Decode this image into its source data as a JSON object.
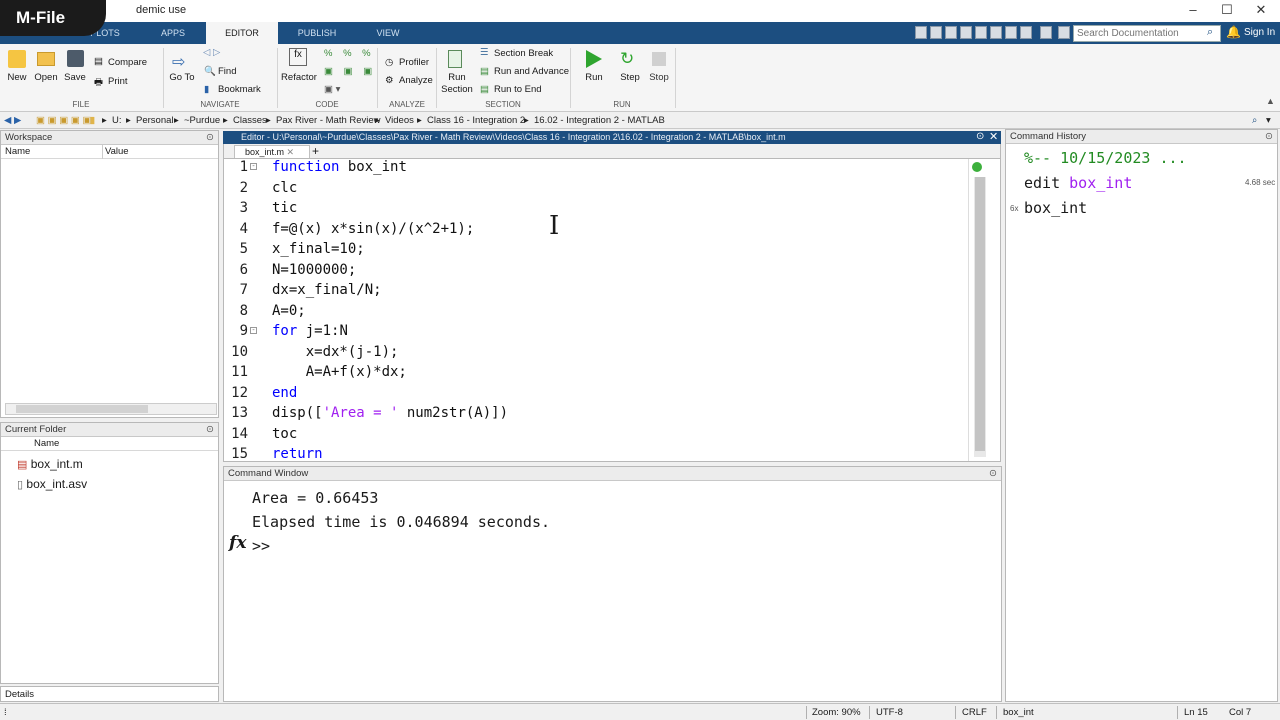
{
  "window": {
    "title": "demic use",
    "overlay": "M-File",
    "controls": [
      "–",
      "☐",
      "✕"
    ]
  },
  "tabs": [
    "PLOTS",
    "APPS",
    "EDITOR",
    "PUBLISH",
    "VIEW"
  ],
  "search": {
    "placeholder": "Search Documentation"
  },
  "signin": "Sign In",
  "ribbon": {
    "file": {
      "new": "New",
      "open": "Open",
      "save": "Save",
      "compare": "Compare",
      "print": "Print",
      "label": "FILE"
    },
    "navigate": {
      "goto": "Go To",
      "find": "Find",
      "bookmark": "Bookmark",
      "label": "NAVIGATE"
    },
    "code": {
      "refactor": "Refactor",
      "label": "CODE"
    },
    "analyze": {
      "profiler": "Profiler",
      "analyze": "Analyze",
      "label": "ANALYZE"
    },
    "section": {
      "run_section": "Run Section",
      "section_break": "Section Break",
      "run_advance": "Run and Advance",
      "run_end": "Run to End",
      "label": "SECTION"
    },
    "run": {
      "run": "Run",
      "step": "Step",
      "stop": "Stop",
      "label": "RUN"
    }
  },
  "path": [
    "U:",
    "Personal",
    "~Purdue",
    "Classes",
    "Pax River - Math Review",
    "Videos",
    "Class 16 - Integration 2",
    "16.02 - Integration 2 - MATLAB"
  ],
  "workspace": {
    "title": "Workspace",
    "col_name": "Name",
    "col_value": "Value"
  },
  "current_folder": {
    "title": "Current Folder",
    "col_name": "Name",
    "files": [
      "box_int.m",
      "box_int.asv"
    ]
  },
  "details": "Details",
  "editor": {
    "title": "Editor - U:\\Personal\\~Purdue\\Classes\\Pax River - Math Review\\Videos\\Class 16 - Integration 2\\16.02 - Integration 2 - MATLAB\\box_int.m",
    "tab": "box_int.m",
    "add": "+",
    "lines": [
      {
        "n": "1",
        "code": "function box_int"
      },
      {
        "n": "2",
        "code": "clc"
      },
      {
        "n": "3",
        "code": "tic"
      },
      {
        "n": "4",
        "code": "f=@(x) x*sin(x)/(x^2+1);"
      },
      {
        "n": "5",
        "code": "x_final=10;"
      },
      {
        "n": "6",
        "code": "N=1000000;"
      },
      {
        "n": "7",
        "code": "dx=x_final/N;"
      },
      {
        "n": "8",
        "code": "A=0;"
      },
      {
        "n": "9",
        "code": "for j=1:N"
      },
      {
        "n": "10",
        "code": "    x=dx*(j-1);"
      },
      {
        "n": "11",
        "code": "    A=A+f(x)*dx;"
      },
      {
        "n": "12",
        "code": "end"
      },
      {
        "n": "13",
        "code": "disp(['Area = ' num2str(A)])"
      },
      {
        "n": "14",
        "code": "toc"
      },
      {
        "n": "15",
        "code": "return"
      }
    ]
  },
  "command_window": {
    "title": "Command Window",
    "lines": [
      "Area = 0.66453",
      "Elapsed time is 0.046894 seconds."
    ],
    "prompt": ">>",
    "fx": "fx"
  },
  "history": {
    "title": "Command History",
    "entries": [
      "%-- 10/15/2023 ...",
      "edit box_int",
      "box_int"
    ],
    "time": "4.68 sec",
    "count": "6x"
  },
  "status": {
    "zoom": "Zoom: 90%",
    "encoding": "UTF-8",
    "eol": "CRLF",
    "file": "box_int",
    "ln": "Ln  15",
    "col": "Col  7"
  },
  "colors": {
    "tabbar": "#1c4e80",
    "keyword": "#0000ff",
    "string": "#a020f0",
    "comment": "#228b22"
  }
}
